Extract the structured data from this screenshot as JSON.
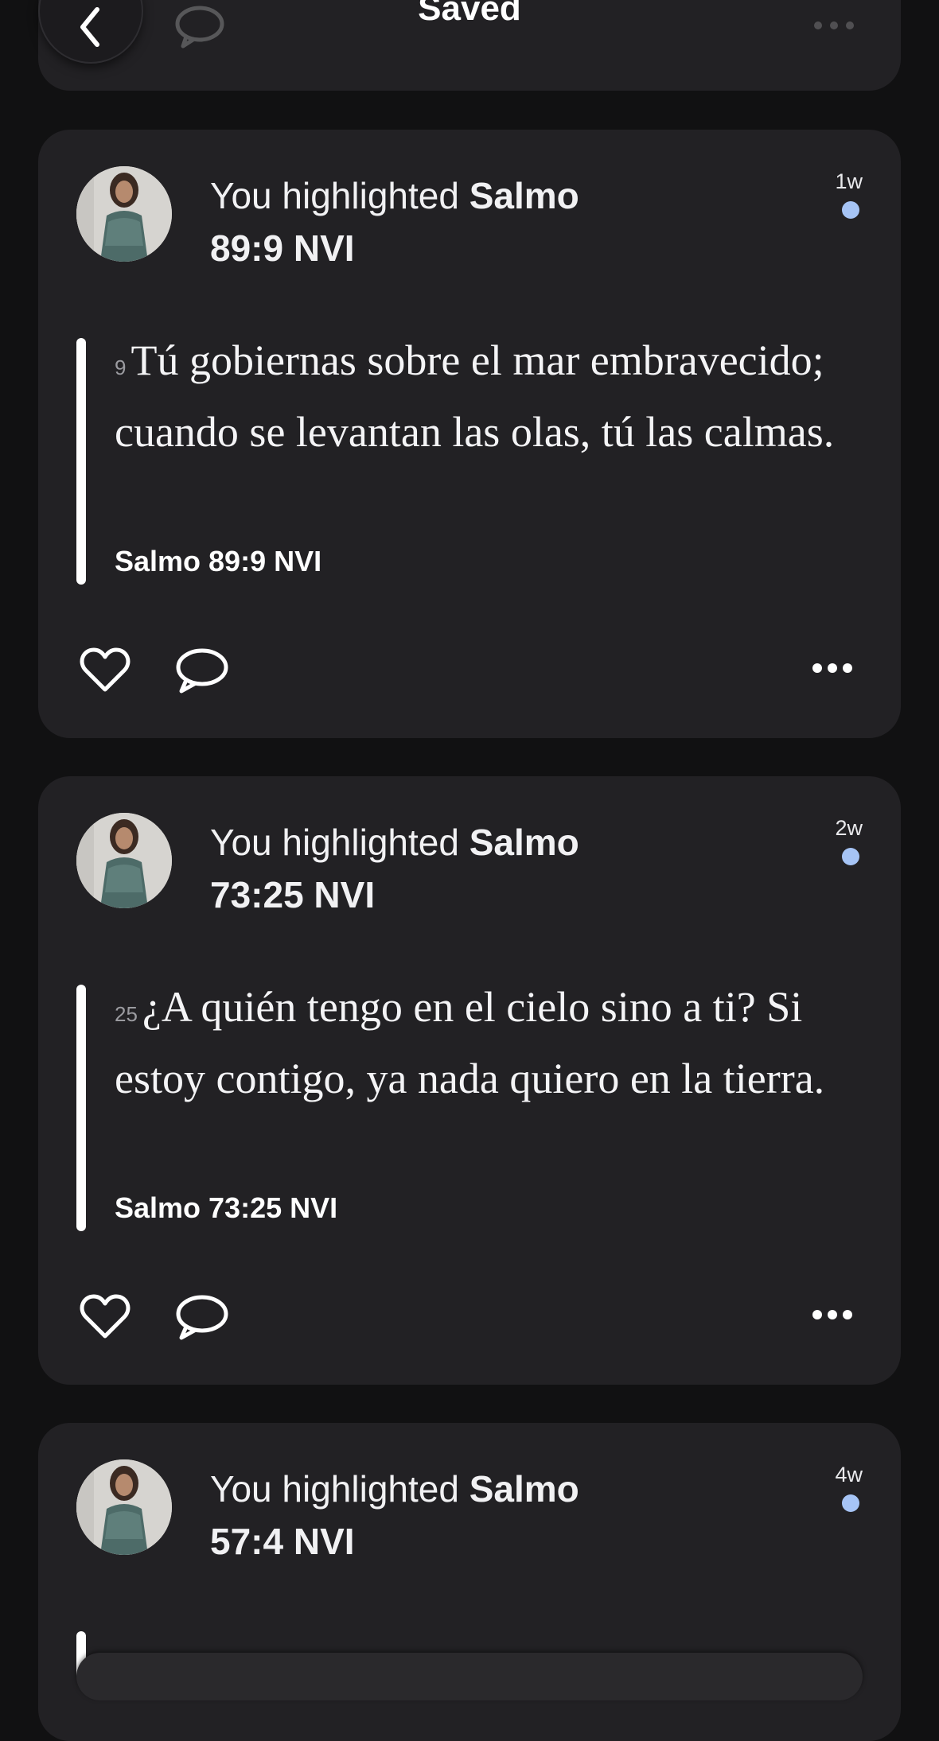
{
  "header": {
    "title": "Saved",
    "back_icon": "chevron-left-icon",
    "comment_icon": "comment-icon",
    "more_icon": "more-icon"
  },
  "colors": {
    "background": "#111112",
    "card": "#222124",
    "unread_dot": "#a6c4f5"
  },
  "posts": [
    {
      "prefix": "You highlighted ",
      "book": "Salmo",
      "chapter_verse": "89:9 NVI",
      "age": "1w",
      "verse_number": "9",
      "verse_text": "Tú gobiernas sobre el mar embravecido; cuando se levantan las olas, tú las calmas.",
      "reference": "Salmo 89:9 NVI"
    },
    {
      "prefix": "You highlighted ",
      "book": "Salmo",
      "chapter_verse": "73:25 NVI",
      "age": "2w",
      "verse_number": "25",
      "verse_text": "¿A quién tengo en el cielo sino a ti? Si estoy contigo, ya nada quiero en la tierra.",
      "reference": "Salmo 73:25 NVI"
    },
    {
      "prefix": "You highlighted ",
      "book": "Salmo",
      "chapter_verse": "57:4 NVI",
      "age": "4w"
    }
  ]
}
